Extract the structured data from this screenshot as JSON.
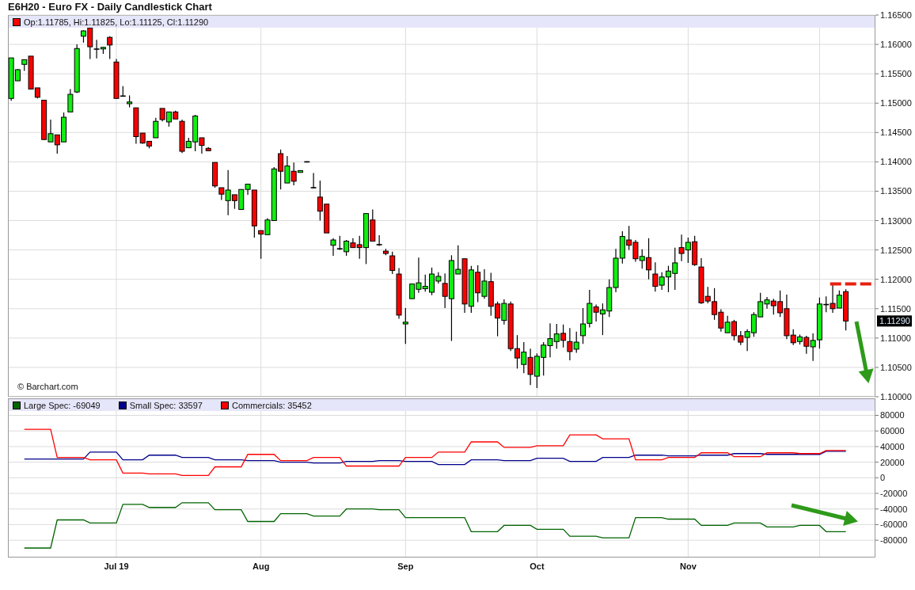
{
  "title": "E6H20 - Euro FX - Daily Candlestick Chart",
  "price_panel": {
    "legend": {
      "label": "Op:1.11785, Hi:1.11825, Lo:1.11125, Cl:1.11290"
    },
    "last_price_label": "1.11290",
    "credit": "© Barchart.com",
    "chart_data": {
      "type": "candlestick",
      "grid": true,
      "ylim": [
        1.1,
        1.165
      ],
      "yticks": [
        {
          "value": 1.165,
          "label": "1.16500"
        },
        {
          "value": 1.16,
          "label": "1.16000"
        },
        {
          "value": 1.155,
          "label": "1.15500"
        },
        {
          "value": 1.15,
          "label": "1.15000"
        },
        {
          "value": 1.145,
          "label": "1.14500"
        },
        {
          "value": 1.14,
          "label": "1.14000"
        },
        {
          "value": 1.135,
          "label": "1.13500"
        },
        {
          "value": 1.13,
          "label": "1.13000"
        },
        {
          "value": 1.125,
          "label": "1.12500"
        },
        {
          "value": 1.12,
          "label": "1.12000"
        },
        {
          "value": 1.115,
          "label": "1.11500"
        },
        {
          "value": 1.11,
          "label": "1.11000"
        },
        {
          "value": 1.105,
          "label": "1.10500"
        },
        {
          "value": 1.1,
          "label": "1.10000"
        }
      ],
      "categories": [
        null,
        null,
        null,
        null,
        null,
        null,
        null,
        null,
        null,
        null,
        null,
        null,
        null,
        null,
        null,
        null,
        null,
        null,
        null,
        null,
        null,
        null,
        null,
        null,
        null,
        null,
        null,
        null,
        null,
        null,
        null,
        null,
        null,
        null,
        null,
        null,
        null,
        null,
        null,
        null,
        null,
        null,
        null,
        null,
        null,
        null,
        null,
        null,
        null,
        null,
        null,
        null,
        null,
        null,
        null,
        null,
        null,
        null,
        null,
        null,
        null,
        null,
        null,
        null,
        null,
        null,
        null,
        null,
        null,
        null,
        null,
        null,
        null,
        null,
        null,
        null,
        null,
        null,
        null,
        null,
        null,
        null,
        null,
        null,
        null,
        null,
        null,
        null,
        null,
        null,
        null,
        null,
        null,
        null,
        null,
        null,
        null,
        null,
        null,
        null,
        null,
        null,
        null,
        null,
        null,
        null,
        null,
        null,
        null,
        null,
        null,
        null,
        null,
        null,
        null,
        null,
        null,
        null,
        null,
        null,
        null,
        null,
        null,
        null,
        null,
        null,
        null,
        null,
        null,
        null,
        null,
        null
      ],
      "ohlc": [
        [
          1.1508,
          1.1577,
          1.1504,
          1.1577
        ],
        [
          1.1538,
          1.1558,
          1.1538,
          1.1557
        ],
        [
          1.1566,
          1.1574,
          1.1555,
          1.1574
        ],
        [
          1.158,
          1.158,
          1.1524,
          1.1524
        ],
        [
          1.1526,
          1.1526,
          1.1508,
          1.151
        ],
        [
          1.1505,
          1.1505,
          1.1438,
          1.1438
        ],
        [
          1.1434,
          1.1472,
          1.1434,
          1.1448
        ],
        [
          1.1446,
          1.1446,
          1.1414,
          1.1429
        ],
        [
          1.1434,
          1.1484,
          1.1434,
          1.1476
        ],
        [
          1.1485,
          1.1524,
          1.1485,
          1.1515
        ],
        [
          1.1519,
          1.16,
          1.1517,
          1.1593
        ],
        [
          1.1614,
          1.1624,
          1.1603,
          1.1623
        ],
        [
          1.1628,
          1.1628,
          1.1575,
          1.1596
        ],
        [
          1.1592,
          1.1608,
          1.1576,
          1.1592
        ],
        [
          1.1593,
          1.1596,
          1.1584,
          1.1595
        ],
        [
          1.1612,
          1.1614,
          1.1575,
          1.1599
        ],
        [
          1.157,
          1.1575,
          1.1508,
          1.1508
        ],
        [
          1.1513,
          1.1529,
          1.1511,
          1.1512
        ],
        [
          1.1499,
          1.1513,
          1.1493,
          1.1502
        ],
        [
          1.1492,
          1.1492,
          1.1431,
          1.1443
        ],
        [
          1.1449,
          1.1449,
          1.1431,
          1.1432
        ],
        [
          1.1435,
          1.1435,
          1.1423,
          1.1427
        ],
        [
          1.1441,
          1.1475,
          1.1441,
          1.1469
        ],
        [
          1.1491,
          1.1491,
          1.1469,
          1.1472
        ],
        [
          1.1468,
          1.1485,
          1.146,
          1.1485
        ],
        [
          1.1485,
          1.1487,
          1.1473,
          1.1473
        ],
        [
          1.1469,
          1.1472,
          1.1415,
          1.1418
        ],
        [
          1.1424,
          1.1441,
          1.1424,
          1.1435
        ],
        [
          1.1434,
          1.148,
          1.1418,
          1.1478
        ],
        [
          1.1441,
          1.1441,
          1.1414,
          1.1428
        ],
        [
          1.1423,
          1.1425,
          1.1419,
          1.1419
        ],
        [
          1.1399,
          1.1399,
          1.1356,
          1.1359
        ],
        [
          1.1356,
          1.1356,
          1.1335,
          1.1345
        ],
        [
          1.1334,
          1.1386,
          1.1309,
          1.1352
        ],
        [
          1.1344,
          1.1344,
          1.132,
          1.1334
        ],
        [
          1.1319,
          1.1353,
          1.1319,
          1.1353
        ],
        [
          1.1353,
          1.1362,
          1.1344,
          1.1362
        ],
        [
          1.1352,
          1.1352,
          1.1271,
          1.1291
        ],
        [
          1.1283,
          1.1283,
          1.1235,
          1.1277
        ],
        [
          1.1276,
          1.1304,
          1.1276,
          1.1301
        ],
        [
          1.13,
          1.1391,
          1.13,
          1.1388
        ],
        [
          1.1414,
          1.1421,
          1.1353,
          1.1384
        ],
        [
          1.1364,
          1.141,
          1.1364,
          1.1393
        ],
        [
          1.1384,
          1.1399,
          1.136,
          1.1367
        ],
        [
          1.1382,
          1.1386,
          1.1382,
          1.1385
        ],
        [
          1.14,
          1.1401,
          1.1399,
          1.14
        ],
        [
          1.1356,
          1.1381,
          1.1355,
          1.1356
        ],
        [
          1.134,
          1.1368,
          1.13,
          1.1316
        ],
        [
          1.1328,
          1.1328,
          1.1279,
          1.1279
        ],
        [
          1.1258,
          1.127,
          1.124,
          1.1267
        ],
        [
          1.1251,
          1.1274,
          1.125,
          1.1252
        ],
        [
          1.1247,
          1.1267,
          1.124,
          1.1265
        ],
        [
          1.1262,
          1.127,
          1.1254,
          1.1254
        ],
        [
          1.1259,
          1.1274,
          1.1235,
          1.1254
        ],
        [
          1.1254,
          1.1312,
          1.1226,
          1.1312
        ],
        [
          1.1301,
          1.1319,
          1.1265,
          1.1265
        ],
        [
          1.1259,
          1.1275,
          1.1257,
          1.1259
        ],
        [
          1.1248,
          1.1252,
          1.1241,
          1.1244
        ],
        [
          1.124,
          1.1247,
          1.1209,
          1.1215
        ],
        [
          1.1209,
          1.1219,
          1.1133,
          1.1139
        ],
        [
          1.1124,
          1.1151,
          1.109,
          1.1127
        ],
        [
          1.1167,
          1.1192,
          1.1167,
          1.1192
        ],
        [
          1.1183,
          1.1237,
          1.1177,
          1.1194
        ],
        [
          1.1184,
          1.1208,
          1.1179,
          1.1188
        ],
        [
          1.1178,
          1.122,
          1.1173,
          1.1209
        ],
        [
          1.1197,
          1.1212,
          1.1193,
          1.1205
        ],
        [
          1.1193,
          1.121,
          1.1151,
          1.1171
        ],
        [
          1.1167,
          1.1241,
          1.1095,
          1.1232
        ],
        [
          1.1209,
          1.1258,
          1.1209,
          1.1217
        ],
        [
          1.1235,
          1.1235,
          1.1143,
          1.1158
        ],
        [
          1.1154,
          1.1223,
          1.1143,
          1.1216
        ],
        [
          1.1212,
          1.1224,
          1.1161,
          1.1177
        ],
        [
          1.1171,
          1.1217,
          1.1167,
          1.1197
        ],
        [
          1.1196,
          1.1211,
          1.1138,
          1.1154
        ],
        [
          1.1158,
          1.1162,
          1.1103,
          1.1134
        ],
        [
          1.113,
          1.1166,
          1.1123,
          1.1159
        ],
        [
          1.1158,
          1.1162,
          1.1078,
          1.1082
        ],
        [
          1.1082,
          1.1105,
          1.1048,
          1.1066
        ],
        [
          1.1055,
          1.1093,
          1.104,
          1.1076
        ],
        [
          1.1067,
          1.1082,
          1.102,
          1.1038
        ],
        [
          1.1035,
          1.1074,
          1.1015,
          1.1069
        ],
        [
          1.1067,
          1.1093,
          1.1036,
          1.1088
        ],
        [
          1.1087,
          1.1125,
          1.1067,
          1.1099
        ],
        [
          1.1094,
          1.1124,
          1.1082,
          1.1107
        ],
        [
          1.1108,
          1.1123,
          1.1084,
          1.1096
        ],
        [
          1.1094,
          1.1117,
          1.1062,
          1.1077
        ],
        [
          1.1081,
          1.1111,
          1.1075,
          1.1093
        ],
        [
          1.1104,
          1.1151,
          1.109,
          1.1124
        ],
        [
          1.1125,
          1.1182,
          1.1118,
          1.1159
        ],
        [
          1.1153,
          1.1157,
          1.1128,
          1.1144
        ],
        [
          1.1141,
          1.1159,
          1.1105,
          1.1148
        ],
        [
          1.1146,
          1.12,
          1.1136,
          1.1186
        ],
        [
          1.1186,
          1.1252,
          1.1178,
          1.1236
        ],
        [
          1.1236,
          1.1282,
          1.1227,
          1.1273
        ],
        [
          1.1267,
          1.1291,
          1.125,
          1.1258
        ],
        [
          1.1263,
          1.1267,
          1.123,
          1.1235
        ],
        [
          1.1232,
          1.1251,
          1.1218,
          1.1239
        ],
        [
          1.1237,
          1.127,
          1.12,
          1.1216
        ],
        [
          1.1209,
          1.1229,
          1.1179,
          1.1188
        ],
        [
          1.119,
          1.1212,
          1.1182,
          1.1204
        ],
        [
          1.1204,
          1.1223,
          1.1178,
          1.1214
        ],
        [
          1.121,
          1.1254,
          1.1182,
          1.1228
        ],
        [
          1.1254,
          1.1276,
          1.1231,
          1.1244
        ],
        [
          1.125,
          1.1271,
          1.1228,
          1.1263
        ],
        [
          1.1264,
          1.1274,
          1.1223,
          1.1225
        ],
        [
          1.1221,
          1.1236,
          1.1158,
          1.116
        ],
        [
          1.1171,
          1.1187,
          1.1159,
          1.1163
        ],
        [
          1.1162,
          1.1185,
          1.1131,
          1.114
        ],
        [
          1.1144,
          1.1149,
          1.1111,
          1.1117
        ],
        [
          1.1109,
          1.1138,
          1.1109,
          1.1127
        ],
        [
          1.1128,
          1.1131,
          1.1096,
          1.1104
        ],
        [
          1.1104,
          1.1112,
          1.1088,
          1.1093
        ],
        [
          1.1101,
          1.1115,
          1.1078,
          1.1111
        ],
        [
          1.1109,
          1.1144,
          1.1102,
          1.114
        ],
        [
          1.1136,
          1.1177,
          1.1136,
          1.1162
        ],
        [
          1.1158,
          1.117,
          1.115,
          1.1165
        ],
        [
          1.1163,
          1.1167,
          1.114,
          1.1155
        ],
        [
          1.1162,
          1.1181,
          1.1136,
          1.1143
        ],
        [
          1.115,
          1.1174,
          1.1098,
          1.1104
        ],
        [
          1.1105,
          1.1115,
          1.1088,
          1.1092
        ],
        [
          1.1094,
          1.1106,
          1.1089,
          1.1102
        ],
        [
          1.1101,
          1.1104,
          1.1073,
          1.1086
        ],
        [
          1.1085,
          1.1108,
          1.1061,
          1.1096
        ],
        [
          1.1097,
          1.1169,
          1.1082,
          1.1158
        ],
        [
          1.1157,
          1.1171,
          1.1144,
          1.1157
        ],
        [
          1.1159,
          1.1191,
          1.1143,
          1.115
        ],
        [
          1.1151,
          1.1181,
          1.1151,
          1.1173
        ],
        [
          1.1179,
          1.1183,
          1.1113,
          1.1129
        ],
        null,
        null,
        null,
        null
      ]
    }
  },
  "cot_panel": {
    "chart_data": {
      "type": "line",
      "grid": true,
      "legend": true,
      "ylim": [
        -102200,
        101800
      ],
      "categories": [
        null,
        null,
        null,
        null,
        null,
        null,
        null,
        null,
        null,
        null,
        null,
        null,
        null,
        null,
        null,
        null,
        "Jul 19",
        null,
        null,
        null,
        null,
        null,
        null,
        null,
        null,
        null,
        null,
        null,
        null,
        null,
        null,
        null,
        null,
        null,
        null,
        null,
        null,
        null,
        "Aug",
        null,
        null,
        null,
        null,
        null,
        null,
        null,
        null,
        null,
        null,
        null,
        null,
        null,
        null,
        null,
        null,
        null,
        null,
        null,
        null,
        null,
        "Sep",
        null,
        null,
        null,
        null,
        null,
        null,
        null,
        null,
        null,
        null,
        null,
        null,
        null,
        null,
        null,
        null,
        null,
        null,
        null,
        "Oct",
        null,
        null,
        null,
        null,
        null,
        null,
        null,
        null,
        null,
        null,
        null,
        null,
        null,
        null,
        null,
        null,
        null,
        null,
        null,
        null,
        null,
        null,
        "Nov",
        null,
        null,
        null,
        null,
        null,
        null,
        null,
        null,
        null,
        null,
        null,
        null,
        null,
        null,
        null,
        null,
        null,
        null,
        null,
        null,
        null,
        null,
        null,
        null,
        null,
        null,
        null,
        null
      ],
      "yticks": [
        {
          "value": 80000,
          "label": "80000"
        },
        {
          "value": 60000,
          "label": "60000"
        },
        {
          "value": 40000,
          "label": "40000"
        },
        {
          "value": 20000,
          "label": "20000"
        },
        {
          "value": 0,
          "label": "0"
        },
        {
          "value": -20000,
          "label": "-20000"
        },
        {
          "value": -40000,
          "label": "-40000"
        },
        {
          "value": -60000,
          "label": "-60000"
        },
        {
          "value": -80000,
          "label": "-80000"
        }
      ],
      "series": [
        {
          "name": "Large Spec: -69049",
          "color": "#006400",
          "values": [
            null,
            null,
            -90000,
            -90000,
            -90000,
            -90000,
            -90000,
            -54000,
            -54000,
            -54000,
            -54000,
            -54000,
            -58000,
            -58000,
            -58000,
            -58000,
            -58000,
            -34000,
            -34000,
            -34000,
            -34000,
            -38000,
            -38000,
            -38000,
            -38000,
            -38000,
            -32000,
            -32000,
            -32000,
            -32000,
            -32000,
            -41000,
            -41000,
            -41000,
            -41000,
            -41000,
            -56000,
            -56000,
            -56000,
            -56000,
            -56000,
            -46000,
            -46000,
            -46000,
            -46000,
            -46000,
            -49000,
            -49000,
            -49000,
            -49000,
            -49000,
            -40000,
            -40000,
            -40000,
            -40000,
            -40000,
            -41000,
            -41000,
            -41000,
            -41000,
            -51000,
            -51000,
            -51000,
            -51000,
            -51000,
            -51000,
            -51000,
            -51000,
            -51000,
            -51000,
            -69000,
            -69000,
            -69000,
            -69000,
            -69000,
            -61000,
            -61000,
            -61000,
            -61000,
            -61000,
            -66000,
            -66000,
            -66000,
            -66000,
            -66000,
            -75000,
            -75000,
            -75000,
            -75000,
            -75000,
            -77000,
            -77000,
            -77000,
            -77000,
            -77000,
            -51000,
            -51000,
            -51000,
            -51000,
            -51000,
            -53000,
            -53000,
            -53000,
            -53000,
            -53000,
            -61000,
            -61000,
            -61000,
            -61000,
            -61000,
            -58000,
            -58000,
            -58000,
            -58000,
            -58000,
            -63000,
            -63000,
            -63000,
            -63000,
            -63000,
            -61000,
            -61000,
            -61000,
            -61000,
            -69000,
            -69000,
            -69000,
            -69000,
            null,
            null,
            null,
            null
          ]
        },
        {
          "name": "Small Spec: 33597",
          "color": "#00008b",
          "values": [
            null,
            null,
            24000,
            24000,
            24000,
            24000,
            24000,
            24000,
            24000,
            24000,
            24000,
            24000,
            33000,
            33000,
            33000,
            33000,
            33000,
            23000,
            23000,
            23000,
            23000,
            29000,
            29000,
            29000,
            29000,
            29000,
            26000,
            26000,
            26000,
            26000,
            26000,
            23000,
            23000,
            23000,
            23000,
            23000,
            22000,
            22000,
            22000,
            22000,
            22000,
            20000,
            20000,
            20000,
            20000,
            20000,
            19000,
            19000,
            19000,
            19000,
            19000,
            21000,
            21000,
            21000,
            21000,
            21000,
            22000,
            22000,
            22000,
            22000,
            21000,
            21000,
            21000,
            21000,
            21000,
            17000,
            17000,
            17000,
            17000,
            17000,
            23000,
            23000,
            23000,
            23000,
            23000,
            22000,
            22000,
            22000,
            22000,
            22000,
            25000,
            25000,
            25000,
            25000,
            25000,
            21000,
            21000,
            21000,
            21000,
            21000,
            26000,
            26000,
            26000,
            26000,
            26000,
            29000,
            29000,
            29000,
            29000,
            29000,
            28000,
            28000,
            28000,
            28000,
            28000,
            29000,
            29000,
            29000,
            29000,
            29000,
            31000,
            31000,
            31000,
            31000,
            31000,
            30000,
            30000,
            30000,
            30000,
            30000,
            30000,
            30000,
            30000,
            30000,
            34000,
            34000,
            34000,
            34000,
            null,
            null,
            null,
            null
          ]
        },
        {
          "name": "Commercials: 35452",
          "color": "#ff0000",
          "values": [
            null,
            null,
            62000,
            62000,
            62000,
            62000,
            62000,
            26000,
            26000,
            26000,
            26000,
            26000,
            23000,
            23000,
            23000,
            23000,
            23000,
            6000,
            6000,
            6000,
            6000,
            5000,
            5000,
            5000,
            5000,
            5000,
            3000,
            3000,
            3000,
            3000,
            3000,
            14000,
            14000,
            14000,
            14000,
            14000,
            30000,
            30000,
            30000,
            30000,
            30000,
            22000,
            22000,
            22000,
            22000,
            22000,
            26000,
            26000,
            26000,
            26000,
            26000,
            15000,
            15000,
            15000,
            15000,
            15000,
            15000,
            15000,
            15000,
            15000,
            26000,
            26000,
            26000,
            26000,
            26000,
            33000,
            33000,
            33000,
            33000,
            33000,
            46000,
            46000,
            46000,
            46000,
            46000,
            39000,
            39000,
            39000,
            39000,
            39000,
            41000,
            41000,
            41000,
            41000,
            41000,
            55000,
            55000,
            55000,
            55000,
            55000,
            50000,
            50000,
            50000,
            50000,
            50000,
            23000,
            23000,
            23000,
            23000,
            23000,
            26000,
            26000,
            26000,
            26000,
            26000,
            32000,
            32000,
            32000,
            32000,
            32000,
            27000,
            27000,
            27000,
            27000,
            27000,
            32000,
            32000,
            32000,
            32000,
            32000,
            31000,
            31000,
            31000,
            31000,
            35000,
            35000,
            35000,
            35000,
            null,
            null,
            null,
            null
          ]
        }
      ]
    }
  }
}
